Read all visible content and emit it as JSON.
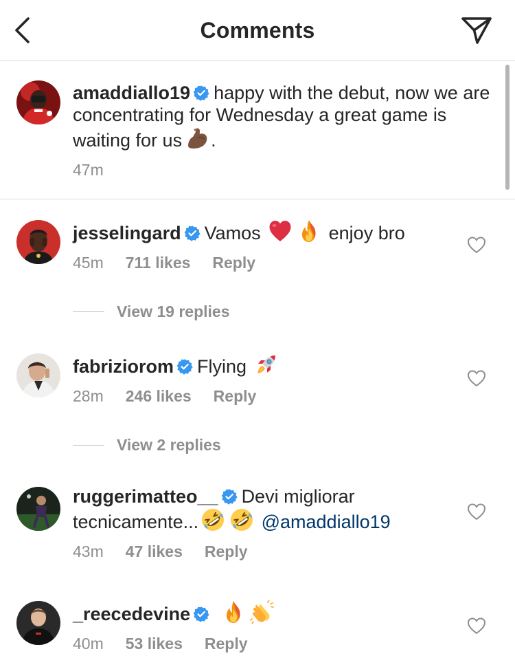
{
  "header": {
    "title": "Comments",
    "back_icon": "chevron-left-icon",
    "share_icon": "paper-plane-icon"
  },
  "caption": {
    "username": "amaddiallo19",
    "verified": true,
    "text": "happy with the debut, now we are concentrating for Wednesday a great game is waiting for us",
    "emoji": "flexed-biceps",
    "text_end": ".",
    "time": "47m"
  },
  "comments": [
    {
      "username": "jesselingard",
      "verified": true,
      "text_start": "Vamos",
      "emojis": [
        "red-heart",
        "fire"
      ],
      "text_end": "enjoy bro",
      "time": "45m",
      "likes": "711 likes",
      "reply": "Reply",
      "view_replies": "View 19 replies"
    },
    {
      "username": "fabriziorom",
      "verified": true,
      "text_start": "Flying",
      "emojis": [
        "rocket"
      ],
      "time": "28m",
      "likes": "246 likes",
      "reply": "Reply",
      "view_replies": "View 2 replies"
    },
    {
      "username": "ruggerimatteo__",
      "verified": true,
      "text_start": "Devi migliorar",
      "text_line2": "tecnicamente...",
      "emojis": [
        "rolling-on-floor-laughing",
        "rolling-on-floor-laughing"
      ],
      "mention": "@amaddiallo19",
      "time": "43m",
      "likes": "47 likes",
      "reply": "Reply"
    },
    {
      "username": "_reecedevine",
      "verified": true,
      "emojis": [
        "fire",
        "clapping-hands"
      ],
      "time": "40m",
      "likes": "53 likes",
      "reply": "Reply"
    }
  ],
  "colors": {
    "text": "#262626",
    "secondary": "#8e8e8e",
    "verified": "#3897f0",
    "mention": "#00376b",
    "divider": "#dbdbdb"
  }
}
